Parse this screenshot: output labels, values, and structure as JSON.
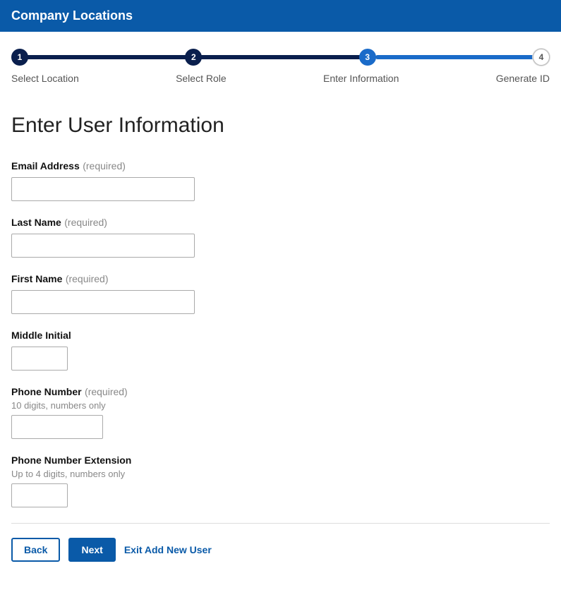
{
  "header": {
    "title": "Company Locations"
  },
  "wizard": {
    "steps": [
      {
        "num": "1",
        "label": "Select Location"
      },
      {
        "num": "2",
        "label": "Select Role"
      },
      {
        "num": "3",
        "label": "Enter Information"
      },
      {
        "num": "4",
        "label": "Generate ID"
      }
    ]
  },
  "page": {
    "title": "Enter User Information"
  },
  "fields": {
    "email": {
      "label": "Email Address",
      "required": "(required)",
      "value": ""
    },
    "lastName": {
      "label": "Last Name",
      "required": "(required)",
      "value": ""
    },
    "firstName": {
      "label": "First Name",
      "required": "(required)",
      "value": ""
    },
    "middleInitial": {
      "label": "Middle Initial",
      "value": ""
    },
    "phone": {
      "label": "Phone Number",
      "required": "(required)",
      "hint": "10 digits, numbers only",
      "value": ""
    },
    "extension": {
      "label": "Phone Number Extension",
      "hint": "Up to 4 digits, numbers only",
      "value": ""
    }
  },
  "actions": {
    "back": "Back",
    "next": "Next",
    "exit": "Exit Add New User"
  }
}
